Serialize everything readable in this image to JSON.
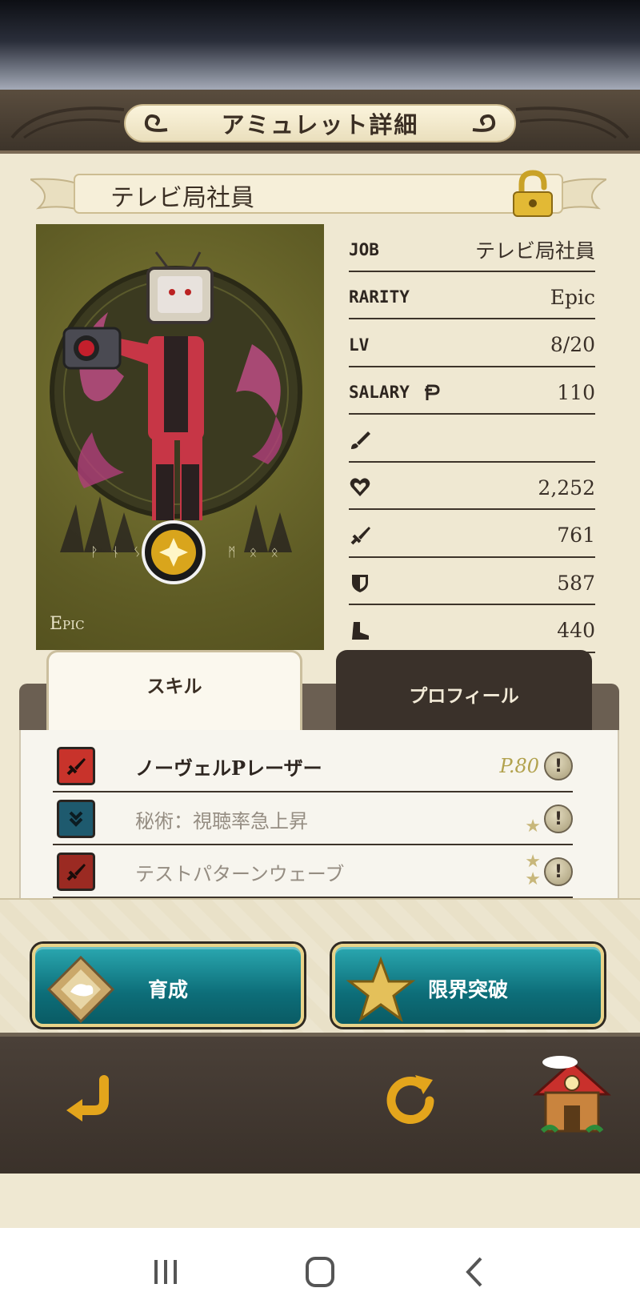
{
  "header": {
    "title": "アミュレット詳細"
  },
  "amulet": {
    "name": "テレビ局社員",
    "rarity_label": "Epic",
    "runes_left": "ᚹ ᚾ ᛊ",
    "runes_right": "ᛗ ᛟ ᛟ"
  },
  "stats": [
    {
      "label": "JOB",
      "value": "テレビ局社員",
      "icon": null
    },
    {
      "label": "RARITY",
      "value": "Epic",
      "icon": null
    },
    {
      "label": "LV",
      "value": "8/20",
      "icon": null
    },
    {
      "label": "SALARY",
      "value": "110",
      "icon": "coin-icon"
    },
    {
      "label": "",
      "value": "",
      "icon": "brush-icon"
    },
    {
      "label": "",
      "value": "2,252",
      "icon": "heart-icon"
    },
    {
      "label": "",
      "value": "761",
      "icon": "sword-icon"
    },
    {
      "label": "",
      "value": "587",
      "icon": "shield-icon"
    },
    {
      "label": "",
      "value": "440",
      "icon": "boot-icon"
    }
  ],
  "tabs": {
    "skill": "スキル",
    "profile": "プロフィール"
  },
  "skills": [
    {
      "name": "ノーヴェルPレーザー",
      "cost": "P.80",
      "stars": 0,
      "color": "#c8332b",
      "icon": "sword-skill-icon",
      "active": true
    },
    {
      "name": "秘術：視聴率急上昇",
      "cost": "",
      "stars": 1,
      "color": "#1e5a6e",
      "icon": "chevron-skill-icon",
      "active": false
    },
    {
      "name": "テストパターンウェーブ",
      "cost": "",
      "stars": 2,
      "color": "#9b2a22",
      "icon": "sword-skill-icon",
      "active": false
    }
  ],
  "info_glyph": "!",
  "star_glyph": "★",
  "actions": {
    "train": "育成",
    "limit_break": "限界突破"
  },
  "colors": {
    "accent_teal": "#0d6e79",
    "gold": "#e9d48a",
    "panel": "#efe8d2"
  }
}
